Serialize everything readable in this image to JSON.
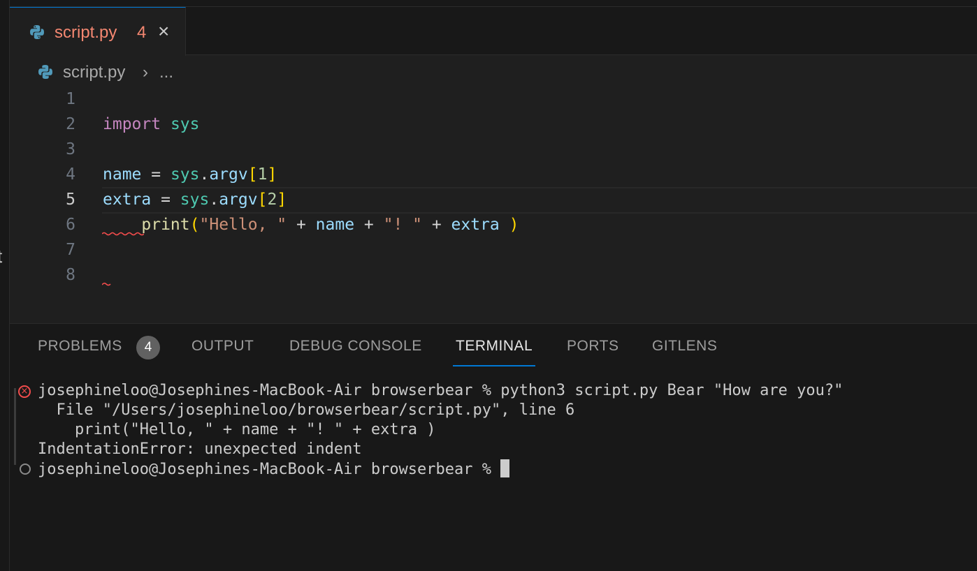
{
  "editor_tab": {
    "title": "script.py",
    "problem_count": "4",
    "close_glyph": "×"
  },
  "breadcrumb": {
    "file": "script.py",
    "separator": "›",
    "more": "..."
  },
  "editor": {
    "active_line": 5,
    "lines": [
      {
        "n": "1",
        "tokens": []
      },
      {
        "n": "2",
        "tokens": [
          [
            "kw",
            "import"
          ],
          [
            "op",
            " "
          ],
          [
            "mod",
            "sys"
          ]
        ]
      },
      {
        "n": "3",
        "tokens": []
      },
      {
        "n": "4",
        "tokens": [
          [
            "var",
            "name"
          ],
          [
            "op",
            " = "
          ],
          [
            "mod",
            "sys"
          ],
          [
            "op",
            "."
          ],
          [
            "var",
            "argv"
          ],
          [
            "br",
            "["
          ],
          [
            "num",
            "1"
          ],
          [
            "br",
            "]"
          ]
        ]
      },
      {
        "n": "5",
        "tokens": [
          [
            "var",
            "extra"
          ],
          [
            "op",
            " = "
          ],
          [
            "mod",
            "sys"
          ],
          [
            "op",
            "."
          ],
          [
            "var",
            "argv"
          ],
          [
            "br",
            "["
          ],
          [
            "num",
            "2"
          ],
          [
            "br",
            "]"
          ]
        ]
      },
      {
        "n": "6",
        "tokens": [
          [
            "op",
            "    "
          ],
          [
            "fn",
            "print"
          ],
          [
            "br",
            "("
          ],
          [
            "str",
            "\"Hello, \""
          ],
          [
            "op",
            " + "
          ],
          [
            "var",
            "name"
          ],
          [
            "op",
            " + "
          ],
          [
            "str",
            "\"! \""
          ],
          [
            "op",
            " + "
          ],
          [
            "var",
            "extra"
          ],
          [
            "op",
            " "
          ],
          [
            "br",
            ")"
          ]
        ]
      },
      {
        "n": "7",
        "tokens": []
      },
      {
        "n": "8",
        "tokens": []
      }
    ]
  },
  "panel": {
    "tabs": [
      {
        "label": "PROBLEMS",
        "badge": "4"
      },
      {
        "label": "OUTPUT"
      },
      {
        "label": "DEBUG CONSOLE"
      },
      {
        "label": "TERMINAL",
        "active": true
      },
      {
        "label": "PORTS"
      },
      {
        "label": "GITLENS"
      }
    ]
  },
  "terminal": {
    "lines": [
      "josephineloo@Josephines-MacBook-Air browserbear % python3 script.py Bear \"How are you?\"",
      "  File \"/Users/josephineloo/browserbear/script.py\", line 6",
      "    print(\"Hello, \" + name + \"! \" + extra )",
      "IndentationError: unexpected indent",
      "josephineloo@Josephines-MacBook-Air browserbear % "
    ]
  },
  "colors": {
    "accent": "#0078d4",
    "error": "#f14c4c",
    "tab_modified": "#f48771"
  },
  "icons": {
    "file_icon": "python-icon",
    "error_icon": "error-circle-icon",
    "prompt_icon": "circle-icon"
  },
  "misc": {
    "stray_glyph": "t"
  }
}
